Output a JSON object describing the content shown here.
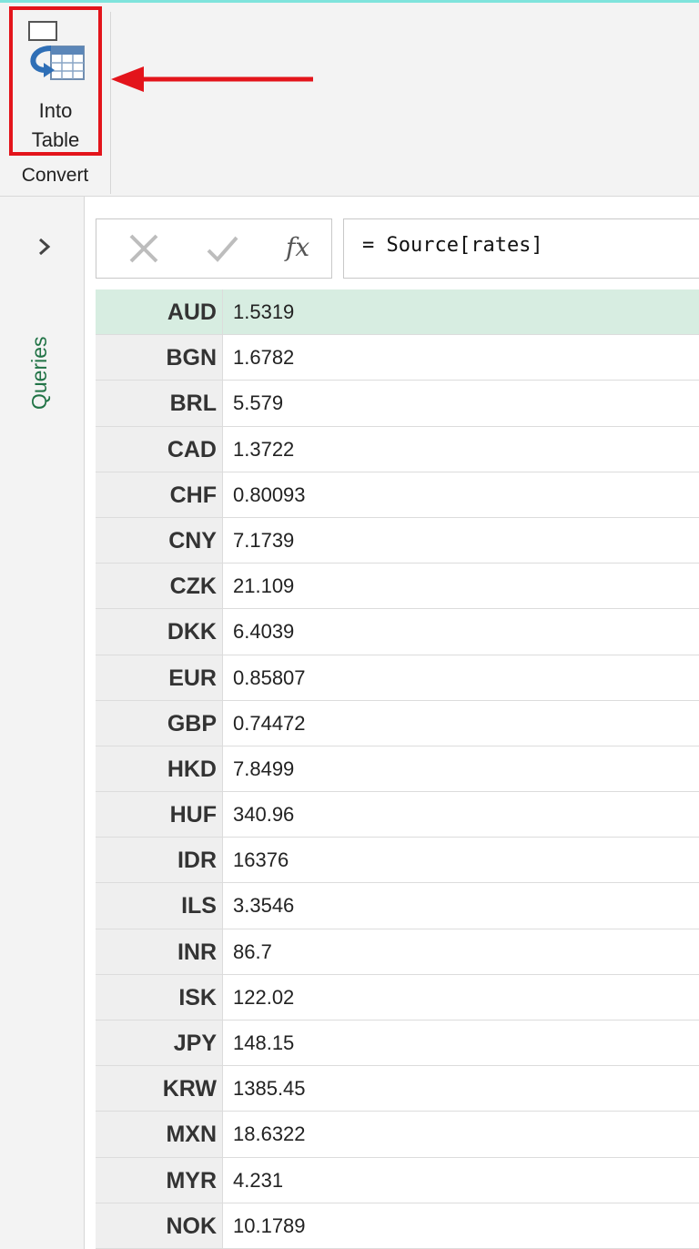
{
  "ribbon": {
    "into_table": {
      "line1": "Into",
      "line2": "Table"
    },
    "group_label": "Convert"
  },
  "sidebar": {
    "queries_label": "Queries"
  },
  "formula_bar": {
    "fx_label": "fx",
    "formula": "= Source[rates]"
  },
  "rates": [
    {
      "key": "AUD",
      "value": "1.5319"
    },
    {
      "key": "BGN",
      "value": "1.6782"
    },
    {
      "key": "BRL",
      "value": "5.579"
    },
    {
      "key": "CAD",
      "value": "1.3722"
    },
    {
      "key": "CHF",
      "value": "0.80093"
    },
    {
      "key": "CNY",
      "value": "7.1739"
    },
    {
      "key": "CZK",
      "value": "21.109"
    },
    {
      "key": "DKK",
      "value": "6.4039"
    },
    {
      "key": "EUR",
      "value": "0.85807"
    },
    {
      "key": "GBP",
      "value": "0.74472"
    },
    {
      "key": "HKD",
      "value": "7.8499"
    },
    {
      "key": "HUF",
      "value": "340.96"
    },
    {
      "key": "IDR",
      "value": "16376"
    },
    {
      "key": "ILS",
      "value": "3.3546"
    },
    {
      "key": "INR",
      "value": "86.7"
    },
    {
      "key": "ISK",
      "value": "122.02"
    },
    {
      "key": "JPY",
      "value": "148.15"
    },
    {
      "key": "KRW",
      "value": "1385.45"
    },
    {
      "key": "MXN",
      "value": "18.6322"
    },
    {
      "key": "MYR",
      "value": "4.231"
    },
    {
      "key": "NOK",
      "value": "10.1789"
    }
  ],
  "colors": {
    "highlight_border": "#e3141b",
    "selected_row": "#d7ede1",
    "accent_green": "#217346"
  }
}
